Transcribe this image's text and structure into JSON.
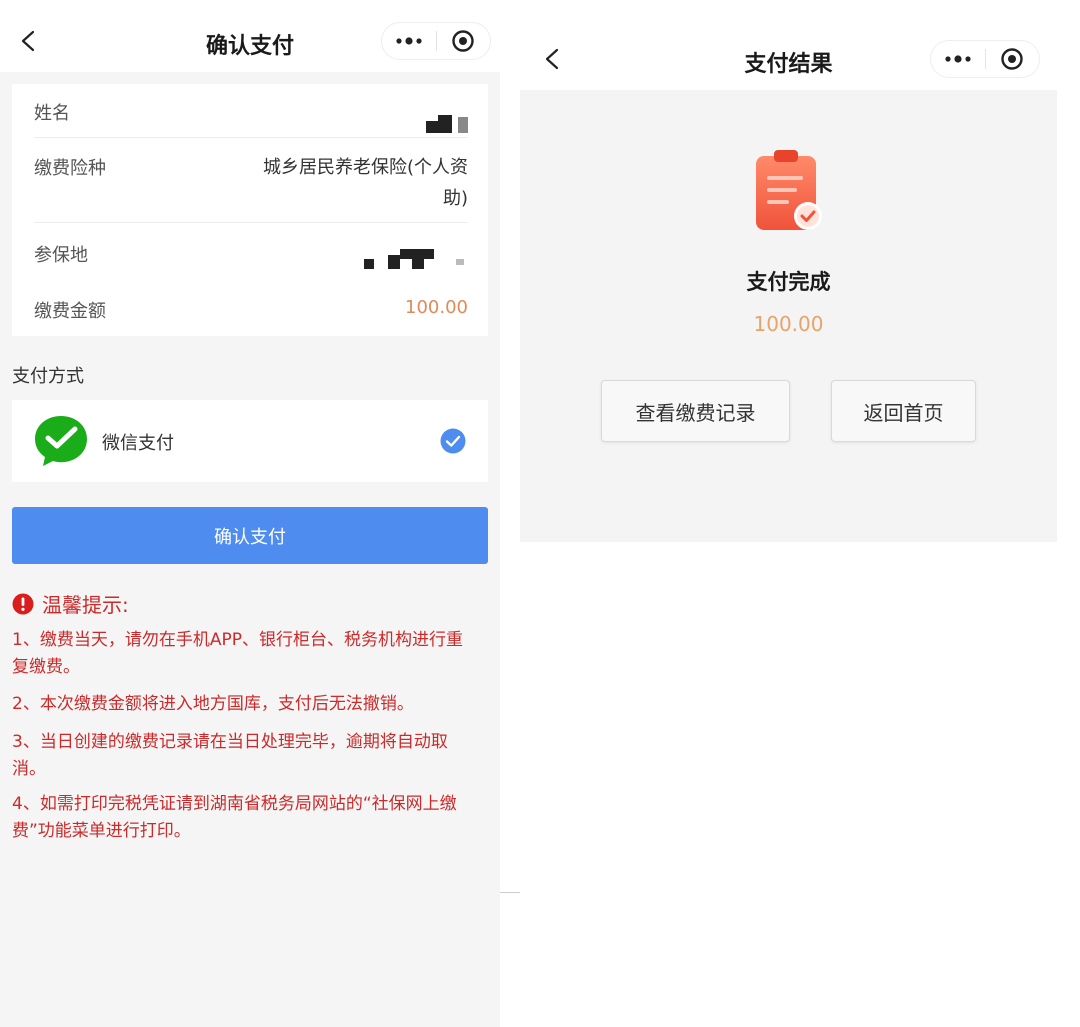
{
  "confirm_screen": {
    "nav": {
      "title": "确认支付"
    },
    "info": {
      "name_label": "姓名",
      "type_label": "缴费险种",
      "type_value_line1": "城乡居民养老保险(个人资",
      "type_value_line2": "助)",
      "place_label": "参保地",
      "amount_label": "缴费金额",
      "amount_value": "100.00"
    },
    "payment": {
      "section_title": "支付方式",
      "method_label": "微信支付"
    },
    "confirm_button": "确认支付",
    "tips": {
      "title": "温馨提示:",
      "items": [
        {
          "line1": "1、缴费当天，请勿在手机APP、银行柜台、税务机构进行重",
          "line2": "复缴费。"
        },
        {
          "line1": "2、本次缴费金额将进入地方国库，支付后无法撤销。",
          "line2": ""
        },
        {
          "line1": "3、当日创建的缴费记录请在当日处理完毕，逾期将自动取",
          "line2": "消。"
        },
        {
          "line1": "4、如需打印完税凭证请到湖南省税务局网站的“社保网上缴",
          "line2": "费”功能菜单进行打印。"
        }
      ]
    }
  },
  "result_screen": {
    "nav": {
      "title": "支付结果"
    },
    "status_title": "支付完成",
    "amount": "100.00",
    "view_records_button": "查看缴费记录",
    "home_button": "返回首页"
  },
  "colors": {
    "primary": "#4e8cf0",
    "warning_text": "#cc2a2a",
    "amount_orange": "#e8a36b",
    "wechat_green": "#1aad19"
  },
  "icons": [
    "back-icon",
    "more-icon",
    "target-icon",
    "wechat-pay-icon",
    "check-circle-icon",
    "alert-icon",
    "clipboard-check-icon"
  ]
}
